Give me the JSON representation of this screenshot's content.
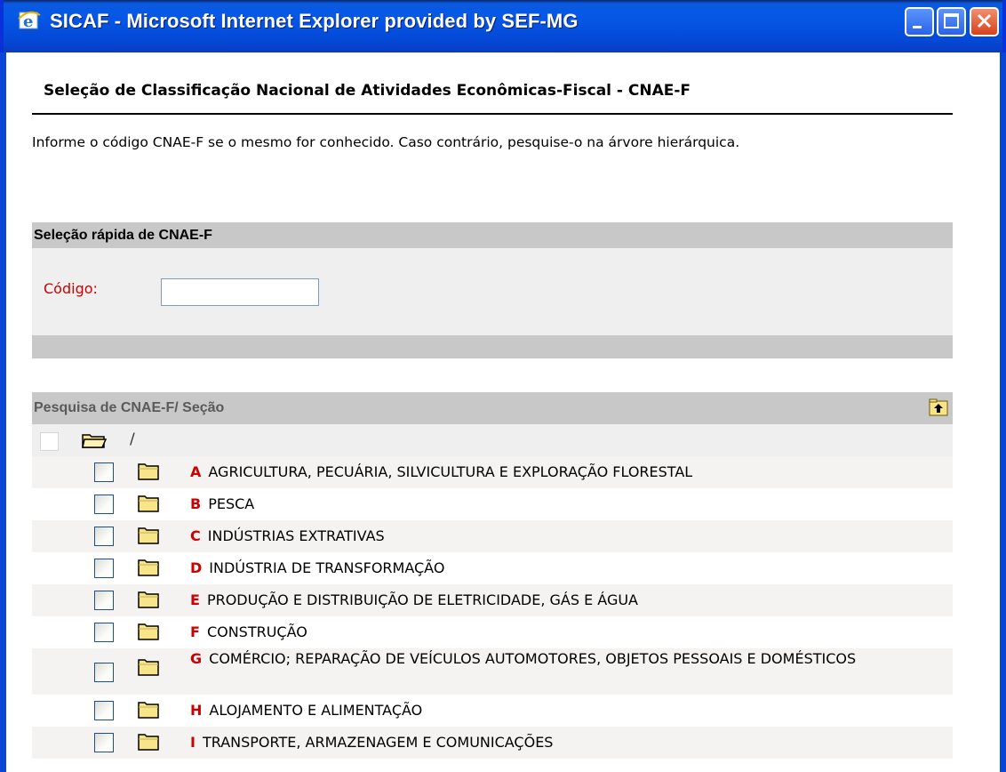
{
  "window": {
    "title": "SICAF - Microsoft Internet Explorer provided by SEF-MG"
  },
  "page": {
    "title": "Seleção de Classificação Nacional de Atividades Econômicas-Fiscal - CNAE-F",
    "info": "Informe o código CNAE-F se o mesmo for conhecido. Caso contrário, pesquise-o na árvore hierárquica."
  },
  "quick": {
    "header": "Seleção rápida de CNAE-F",
    "code_label": "Código:",
    "code_value": ""
  },
  "tree": {
    "header": "Pesquisa de CNAE-F/ Seção",
    "root_path": "/",
    "items": [
      {
        "letter": "A",
        "label": "AGRICULTURA, PECUÁRIA, SILVICULTURA E EXPLORAÇÃO FLORESTAL"
      },
      {
        "letter": "B",
        "label": "PESCA"
      },
      {
        "letter": "C",
        "label": "INDÚSTRIAS EXTRATIVAS"
      },
      {
        "letter": "D",
        "label": "INDÚSTRIA DE TRANSFORMAÇÃO"
      },
      {
        "letter": "E",
        "label": "PRODUÇÃO E DISTRIBUIÇÃO DE ELETRICIDADE, GÁS E ÁGUA"
      },
      {
        "letter": "F",
        "label": "CONSTRUÇÃO"
      },
      {
        "letter": "G",
        "label": "COMÉRCIO; REPARAÇÃO DE VEÍCULOS AUTOMOTORES, OBJETOS PESSOAIS E DOMÉSTICOS"
      },
      {
        "letter": "H",
        "label": "ALOJAMENTO E ALIMENTAÇÃO"
      },
      {
        "letter": "I",
        "label": "TRANSPORTE, ARMAZENAGEM E COMUNICAÇÕES"
      }
    ]
  },
  "colors": {
    "accent_red": "#cc0000",
    "header_gray": "#c8c8c8",
    "xp_blue": "#0a46d6"
  },
  "icons": [
    "ie-icon",
    "minimize-icon",
    "maximize-icon",
    "close-icon",
    "folder-icon",
    "folder-open-icon",
    "folder-up-icon",
    "scroll-up-icon",
    "scroll-down-icon"
  ]
}
